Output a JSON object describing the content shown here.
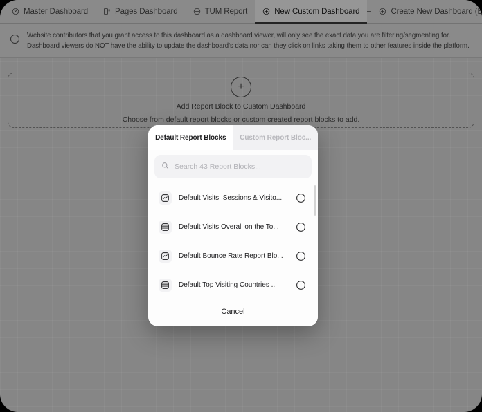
{
  "tabbar": {
    "tabs": [
      {
        "label": "Master Dashboard",
        "icon": "gauge-icon",
        "active": false
      },
      {
        "label": "Pages Dashboard",
        "icon": "pages-icon",
        "active": false
      },
      {
        "label": "TUM Report",
        "icon": "plus-circle-icon",
        "active": false
      },
      {
        "label": "New Custom Dashboard",
        "icon": "plus-circle-icon",
        "active": true
      },
      {
        "label": "Create New Dashboard (BETA)",
        "icon": "plus-circle-icon",
        "active": false
      }
    ],
    "overflow_menu": "tab-overflow-menu"
  },
  "notice": {
    "icon": "info-icon",
    "line1": "Website contributors that you grant access to this dashboard as a dashboard viewer, will only see the exact data you are filtering/segmenting for.",
    "line2": "Dashboard viewers do NOT have the ability to update the dashboard's data nor can they click on links taking them to other features inside the platform."
  },
  "add_block": {
    "plus": "+",
    "title": "Add Report Block to Custom Dashboard",
    "subtitle": "Choose from default report blocks or custom created report blocks to add."
  },
  "modal": {
    "tabs": [
      {
        "label": "Default Report Blocks",
        "active": true
      },
      {
        "label": "Custom Report Bloc...",
        "active": false
      }
    ],
    "search": {
      "placeholder": "Search 43 Report Blocks...",
      "value": "",
      "icon": "search-icon"
    },
    "blocks": [
      {
        "label": "Default Visits, Sessions & Visito...",
        "icon": "chart-block-icon",
        "add_icon": "plus-circle-icon"
      },
      {
        "label": "Default Visits Overall on the To...",
        "icon": "table-block-icon",
        "add_icon": "plus-circle-icon"
      },
      {
        "label": "Default Bounce Rate Report Blo...",
        "icon": "chart-block-icon",
        "add_icon": "plus-circle-icon"
      },
      {
        "label": "Default Top Visiting Countries ...",
        "icon": "table-block-icon",
        "add_icon": "plus-circle-icon"
      },
      {
        "label": "",
        "icon": "table-block-icon",
        "add_icon": "plus-circle-icon"
      }
    ],
    "cancel_label": "Cancel"
  },
  "colors": {
    "dim_overlay": "#868686",
    "frame": "#1b1b1b",
    "modal_bg": "#fdfdfd",
    "text_primary": "#1d1d1f",
    "text_muted": "#b8b8bd"
  }
}
